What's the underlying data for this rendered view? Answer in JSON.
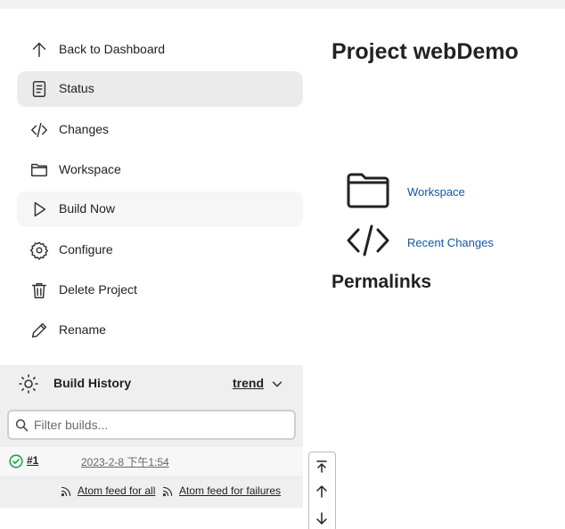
{
  "sidebar": {
    "items": [
      {
        "label": "Back to Dashboard",
        "icon": "arrow-up-icon"
      },
      {
        "label": "Status",
        "icon": "document-icon"
      },
      {
        "label": "Changes",
        "icon": "code-icon"
      },
      {
        "label": "Workspace",
        "icon": "folder-icon"
      },
      {
        "label": "Build Now",
        "icon": "play-icon"
      },
      {
        "label": "Configure",
        "icon": "gear-icon"
      },
      {
        "label": "Delete Project",
        "icon": "trash-icon"
      },
      {
        "label": "Rename",
        "icon": "pencil-icon"
      }
    ]
  },
  "build_history": {
    "title": "Build History",
    "trend_label": "trend",
    "filter_placeholder": "Filter builds...",
    "builds": [
      {
        "number": "#1",
        "date": "2023-2-8 下午1:54",
        "status": "success"
      }
    ],
    "feeds": {
      "all": "Atom feed for all",
      "failures": "Atom feed for failures"
    }
  },
  "main": {
    "title": "Project webDemo",
    "links": [
      {
        "label": "Workspace",
        "icon": "folder-icon"
      },
      {
        "label": "Recent Changes",
        "icon": "code-icon"
      }
    ],
    "permalinks_heading": "Permalinks"
  },
  "colors": {
    "link": "#1155aa",
    "active_bg": "#ebebeb",
    "success": "#1ea64b"
  }
}
